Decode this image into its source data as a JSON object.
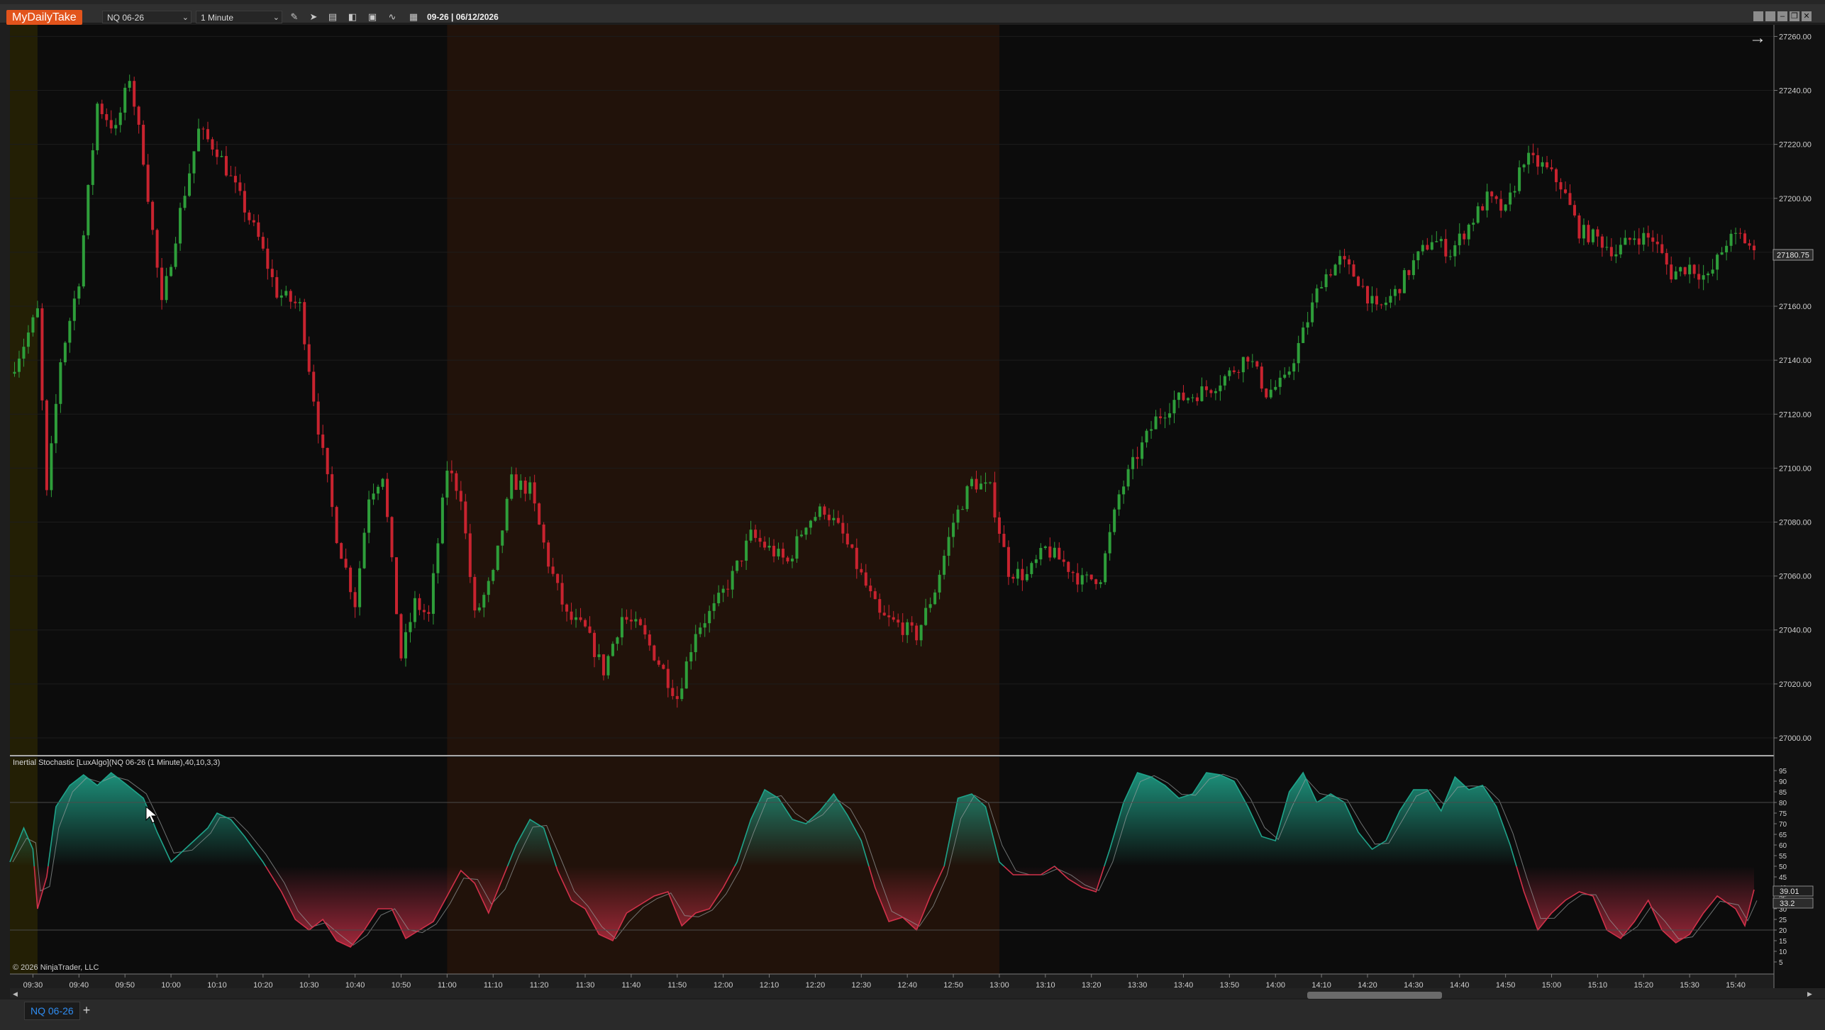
{
  "app": {
    "logo": "MyDailyTake",
    "instrument": "NQ 06-26",
    "timeframe": "1 Minute",
    "date_label": "09-26 | 06/12/2026"
  },
  "toolbar": {
    "icons": [
      "drawing-tool-icon",
      "pointer-icon",
      "data-box-icon",
      "bar-width-icon",
      "zoom-icon",
      "indicators-icon",
      "properties-icon"
    ]
  },
  "window_buttons": [
    "tile-icon",
    "tile-icon",
    "minimize-icon",
    "restore-icon",
    "close-icon"
  ],
  "price_panel": {
    "current_price": "27180.75",
    "axis_labels": [
      "27260.00",
      "27240.00",
      "27220.00",
      "27200.00",
      "27180.00",
      "27160.00",
      "27140.00",
      "27120.00",
      "27100.00",
      "27080.00",
      "27060.00",
      "27040.00",
      "27020.00",
      "27000.00"
    ]
  },
  "indicator_panel": {
    "title": "Inertial Stochastic [LuxAlgo](NQ 06-26 (1 Minute),40,10,3,3)",
    "axis_labels": [
      "95",
      "90",
      "85",
      "80",
      "75",
      "70",
      "65",
      "60",
      "55",
      "50",
      "45",
      "40",
      "35",
      "30",
      "25",
      "20",
      "15",
      "10",
      "5"
    ],
    "value_a": "39.01",
    "value_b": "33.2",
    "copyright": "© 2026 NinjaTrader, LLC"
  },
  "time_axis": [
    "09:30",
    "09:40",
    "09:50",
    "10:00",
    "10:10",
    "10:20",
    "10:30",
    "10:40",
    "10:50",
    "11:00",
    "11:10",
    "11:20",
    "11:30",
    "11:40",
    "11:50",
    "12:00",
    "12:10",
    "12:20",
    "12:30",
    "12:40",
    "12:50",
    "13:00",
    "13:10",
    "13:20",
    "13:30",
    "13:40",
    "13:50",
    "14:00",
    "14:10",
    "14:20",
    "14:30",
    "14:40",
    "14:50",
    "15:00",
    "15:10",
    "15:20",
    "15:30",
    "15:40"
  ],
  "tabs": {
    "active": "NQ 06-26",
    "add": "+"
  },
  "colors": {
    "bull": "#2e9e3a",
    "bear": "#c8232f",
    "stoch_up": "#1fa38a",
    "stoch_down": "#d1314a",
    "premarket_band": "#231f05",
    "session_band": "#21120a",
    "accent": "#e2541c"
  },
  "chart_data": {
    "type": "candlestick",
    "symbol": "NQ 06-26",
    "interval": "1 Minute",
    "session_date": "06/12/2026",
    "x_range": [
      "09:25",
      "15:44"
    ],
    "y_range": [
      26995,
      27263
    ],
    "last_price": 27180.75,
    "close_path": [
      {
        "t": "09:25",
        "p": 27135
      },
      {
        "t": "09:28",
        "p": 27146
      },
      {
        "t": "09:31",
        "p": 27158
      },
      {
        "t": "09:33",
        "p": 27090
      },
      {
        "t": "09:36",
        "p": 27140
      },
      {
        "t": "09:40",
        "p": 27170
      },
      {
        "t": "09:44",
        "p": 27235
      },
      {
        "t": "09:48",
        "p": 27225
      },
      {
        "t": "09:51",
        "p": 27245
      },
      {
        "t": "09:54",
        "p": 27215
      },
      {
        "t": "09:58",
        "p": 27160
      },
      {
        "t": "10:02",
        "p": 27195
      },
      {
        "t": "10:06",
        "p": 27225
      },
      {
        "t": "10:10",
        "p": 27218
      },
      {
        "t": "10:15",
        "p": 27200
      },
      {
        "t": "10:19",
        "p": 27185
      },
      {
        "t": "10:23",
        "p": 27165
      },
      {
        "t": "10:28",
        "p": 27160
      },
      {
        "t": "10:32",
        "p": 27115
      },
      {
        "t": "10:36",
        "p": 27075
      },
      {
        "t": "10:40",
        "p": 27050
      },
      {
        "t": "10:43",
        "p": 27090
      },
      {
        "t": "10:46",
        "p": 27098
      },
      {
        "t": "10:50",
        "p": 27030
      },
      {
        "t": "10:53",
        "p": 27050
      },
      {
        "t": "10:56",
        "p": 27045
      },
      {
        "t": "11:00",
        "p": 27100
      },
      {
        "t": "11:03",
        "p": 27090
      },
      {
        "t": "11:06",
        "p": 27045
      },
      {
        "t": "11:10",
        "p": 27060
      },
      {
        "t": "11:14",
        "p": 27095
      },
      {
        "t": "11:18",
        "p": 27092
      },
      {
        "t": "11:22",
        "p": 27065
      },
      {
        "t": "11:26",
        "p": 27045
      },
      {
        "t": "11:30",
        "p": 27040
      },
      {
        "t": "11:34",
        "p": 27025
      },
      {
        "t": "11:38",
        "p": 27045
      },
      {
        "t": "11:42",
        "p": 27040
      },
      {
        "t": "11:46",
        "p": 27028
      },
      {
        "t": "11:50",
        "p": 27015
      },
      {
        "t": "11:54",
        "p": 27040
      },
      {
        "t": "11:58",
        "p": 27048
      },
      {
        "t": "12:02",
        "p": 27060
      },
      {
        "t": "12:06",
        "p": 27075
      },
      {
        "t": "12:10",
        "p": 27070
      },
      {
        "t": "12:14",
        "p": 27065
      },
      {
        "t": "12:18",
        "p": 27080
      },
      {
        "t": "12:22",
        "p": 27085
      },
      {
        "t": "12:26",
        "p": 27075
      },
      {
        "t": "12:30",
        "p": 27060
      },
      {
        "t": "12:34",
        "p": 27045
      },
      {
        "t": "12:38",
        "p": 27042
      },
      {
        "t": "12:42",
        "p": 27038
      },
      {
        "t": "12:46",
        "p": 27055
      },
      {
        "t": "12:50",
        "p": 27080
      },
      {
        "t": "12:54",
        "p": 27095
      },
      {
        "t": "12:58",
        "p": 27092
      },
      {
        "t": "13:02",
        "p": 27062
      },
      {
        "t": "13:06",
        "p": 27060
      },
      {
        "t": "13:10",
        "p": 27070
      },
      {
        "t": "13:14",
        "p": 27065
      },
      {
        "t": "13:18",
        "p": 27058
      },
      {
        "t": "13:22",
        "p": 27060
      },
      {
        "t": "13:26",
        "p": 27090
      },
      {
        "t": "13:30",
        "p": 27105
      },
      {
        "t": "13:34",
        "p": 27118
      },
      {
        "t": "13:38",
        "p": 27125
      },
      {
        "t": "13:42",
        "p": 27127
      },
      {
        "t": "13:46",
        "p": 27130
      },
      {
        "t": "13:50",
        "p": 27135
      },
      {
        "t": "13:54",
        "p": 27142
      },
      {
        "t": "13:58",
        "p": 27128
      },
      {
        "t": "14:02",
        "p": 27132
      },
      {
        "t": "14:06",
        "p": 27150
      },
      {
        "t": "14:10",
        "p": 27170
      },
      {
        "t": "14:14",
        "p": 27177
      },
      {
        "t": "14:18",
        "p": 27170
      },
      {
        "t": "14:22",
        "p": 27158
      },
      {
        "t": "14:26",
        "p": 27165
      },
      {
        "t": "14:30",
        "p": 27176
      },
      {
        "t": "14:34",
        "p": 27185
      },
      {
        "t": "14:38",
        "p": 27180
      },
      {
        "t": "14:42",
        "p": 27190
      },
      {
        "t": "14:46",
        "p": 27200
      },
      {
        "t": "14:50",
        "p": 27195
      },
      {
        "t": "14:54",
        "p": 27215
      },
      {
        "t": "14:58",
        "p": 27212
      },
      {
        "t": "15:02",
        "p": 27205
      },
      {
        "t": "15:06",
        "p": 27188
      },
      {
        "t": "15:10",
        "p": 27185
      },
      {
        "t": "15:14",
        "p": 27180
      },
      {
        "t": "15:18",
        "p": 27186
      },
      {
        "t": "15:22",
        "p": 27185
      },
      {
        "t": "15:26",
        "p": 27172
      },
      {
        "t": "15:30",
        "p": 27175
      },
      {
        "t": "15:34",
        "p": 27170
      },
      {
        "t": "15:38",
        "p": 27184
      },
      {
        "t": "15:41",
        "p": 27186
      },
      {
        "t": "15:44",
        "p": 27180.75
      }
    ],
    "indicator": {
      "name": "Inertial Stochastic [LuxAlgo]",
      "params": [
        40,
        10,
        3,
        3
      ],
      "y_range": [
        0,
        100
      ],
      "levels": [
        80,
        20
      ],
      "last_values": [
        39.01,
        33.2
      ],
      "series": [
        {
          "t": "09:25",
          "v": 52
        },
        {
          "t": "09:28",
          "v": 68
        },
        {
          "t": "09:30",
          "v": 58
        },
        {
          "t": "09:31",
          "v": 30
        },
        {
          "t": "09:33",
          "v": 45
        },
        {
          "t": "09:35",
          "v": 78
        },
        {
          "t": "09:38",
          "v": 88
        },
        {
          "t": "09:41",
          "v": 93
        },
        {
          "t": "09:44",
          "v": 88
        },
        {
          "t": "09:47",
          "v": 94
        },
        {
          "t": "09:50",
          "v": 89
        },
        {
          "t": "09:54",
          "v": 82
        },
        {
          "t": "09:57",
          "v": 66
        },
        {
          "t": "10:00",
          "v": 52
        },
        {
          "t": "10:04",
          "v": 60
        },
        {
          "t": "10:08",
          "v": 68
        },
        {
          "t": "10:10",
          "v": 75
        },
        {
          "t": "10:13",
          "v": 72
        },
        {
          "t": "10:16",
          "v": 64
        },
        {
          "t": "10:20",
          "v": 52
        },
        {
          "t": "10:24",
          "v": 38
        },
        {
          "t": "10:27",
          "v": 25
        },
        {
          "t": "10:30",
          "v": 20
        },
        {
          "t": "10:33",
          "v": 25
        },
        {
          "t": "10:36",
          "v": 15
        },
        {
          "t": "10:39",
          "v": 12
        },
        {
          "t": "10:42",
          "v": 20
        },
        {
          "t": "10:45",
          "v": 30
        },
        {
          "t": "10:48",
          "v": 30
        },
        {
          "t": "10:51",
          "v": 16
        },
        {
          "t": "10:54",
          "v": 20
        },
        {
          "t": "10:57",
          "v": 24
        },
        {
          "t": "11:00",
          "v": 36
        },
        {
          "t": "11:03",
          "v": 48
        },
        {
          "t": "11:06",
          "v": 42
        },
        {
          "t": "11:09",
          "v": 28
        },
        {
          "t": "11:12",
          "v": 44
        },
        {
          "t": "11:15",
          "v": 60
        },
        {
          "t": "11:18",
          "v": 72
        },
        {
          "t": "11:21",
          "v": 68
        },
        {
          "t": "11:24",
          "v": 48
        },
        {
          "t": "11:27",
          "v": 34
        },
        {
          "t": "11:30",
          "v": 30
        },
        {
          "t": "11:33",
          "v": 18
        },
        {
          "t": "11:36",
          "v": 15
        },
        {
          "t": "11:39",
          "v": 28
        },
        {
          "t": "11:42",
          "v": 32
        },
        {
          "t": "11:45",
          "v": 36
        },
        {
          "t": "11:48",
          "v": 38
        },
        {
          "t": "11:51",
          "v": 22
        },
        {
          "t": "11:54",
          "v": 28
        },
        {
          "t": "11:57",
          "v": 30
        },
        {
          "t": "12:00",
          "v": 40
        },
        {
          "t": "12:03",
          "v": 52
        },
        {
          "t": "12:06",
          "v": 72
        },
        {
          "t": "12:09",
          "v": 86
        },
        {
          "t": "12:12",
          "v": 82
        },
        {
          "t": "12:15",
          "v": 72
        },
        {
          "t": "12:18",
          "v": 70
        },
        {
          "t": "12:21",
          "v": 76
        },
        {
          "t": "12:24",
          "v": 84
        },
        {
          "t": "12:27",
          "v": 74
        },
        {
          "t": "12:30",
          "v": 62
        },
        {
          "t": "12:33",
          "v": 40
        },
        {
          "t": "12:36",
          "v": 24
        },
        {
          "t": "12:39",
          "v": 26
        },
        {
          "t": "12:42",
          "v": 20
        },
        {
          "t": "12:45",
          "v": 36
        },
        {
          "t": "12:48",
          "v": 50
        },
        {
          "t": "12:51",
          "v": 82
        },
        {
          "t": "12:54",
          "v": 84
        },
        {
          "t": "12:57",
          "v": 78
        },
        {
          "t": "13:00",
          "v": 52
        },
        {
          "t": "13:03",
          "v": 46
        },
        {
          "t": "13:06",
          "v": 46
        },
        {
          "t": "13:09",
          "v": 46
        },
        {
          "t": "13:12",
          "v": 50
        },
        {
          "t": "13:15",
          "v": 44
        },
        {
          "t": "13:18",
          "v": 40
        },
        {
          "t": "13:21",
          "v": 38
        },
        {
          "t": "13:24",
          "v": 58
        },
        {
          "t": "13:27",
          "v": 80
        },
        {
          "t": "13:30",
          "v": 94
        },
        {
          "t": "13:33",
          "v": 92
        },
        {
          "t": "13:36",
          "v": 88
        },
        {
          "t": "13:39",
          "v": 82
        },
        {
          "t": "13:42",
          "v": 84
        },
        {
          "t": "13:45",
          "v": 94
        },
        {
          "t": "13:48",
          "v": 93
        },
        {
          "t": "13:51",
          "v": 90
        },
        {
          "t": "13:54",
          "v": 78
        },
        {
          "t": "13:57",
          "v": 64
        },
        {
          "t": "14:00",
          "v": 62
        },
        {
          "t": "14:03",
          "v": 85
        },
        {
          "t": "14:06",
          "v": 94
        },
        {
          "t": "14:09",
          "v": 80
        },
        {
          "t": "14:12",
          "v": 84
        },
        {
          "t": "14:15",
          "v": 80
        },
        {
          "t": "14:18",
          "v": 66
        },
        {
          "t": "14:21",
          "v": 58
        },
        {
          "t": "14:24",
          "v": 62
        },
        {
          "t": "14:27",
          "v": 76
        },
        {
          "t": "14:30",
          "v": 86
        },
        {
          "t": "14:33",
          "v": 86
        },
        {
          "t": "14:36",
          "v": 76
        },
        {
          "t": "14:39",
          "v": 92
        },
        {
          "t": "14:42",
          "v": 86
        },
        {
          "t": "14:45",
          "v": 88
        },
        {
          "t": "14:48",
          "v": 78
        },
        {
          "t": "14:51",
          "v": 60
        },
        {
          "t": "14:54",
          "v": 38
        },
        {
          "t": "14:57",
          "v": 20
        },
        {
          "t": "15:00",
          "v": 28
        },
        {
          "t": "15:03",
          "v": 34
        },
        {
          "t": "15:06",
          "v": 38
        },
        {
          "t": "15:09",
          "v": 36
        },
        {
          "t": "15:12",
          "v": 20
        },
        {
          "t": "15:15",
          "v": 16
        },
        {
          "t": "15:18",
          "v": 24
        },
        {
          "t": "15:21",
          "v": 34
        },
        {
          "t": "15:24",
          "v": 20
        },
        {
          "t": "15:27",
          "v": 14
        },
        {
          "t": "15:30",
          "v": 18
        },
        {
          "t": "15:33",
          "v": 28
        },
        {
          "t": "15:36",
          "v": 36
        },
        {
          "t": "15:40",
          "v": 30
        },
        {
          "t": "15:42",
          "v": 22
        },
        {
          "t": "15:44",
          "v": 39
        }
      ]
    },
    "shaded_sessions": [
      {
        "from": "09:25",
        "to": "09:31",
        "color": "premarket_band"
      },
      {
        "from": "11:00",
        "to": "13:00",
        "color": "session_band"
      }
    ]
  }
}
